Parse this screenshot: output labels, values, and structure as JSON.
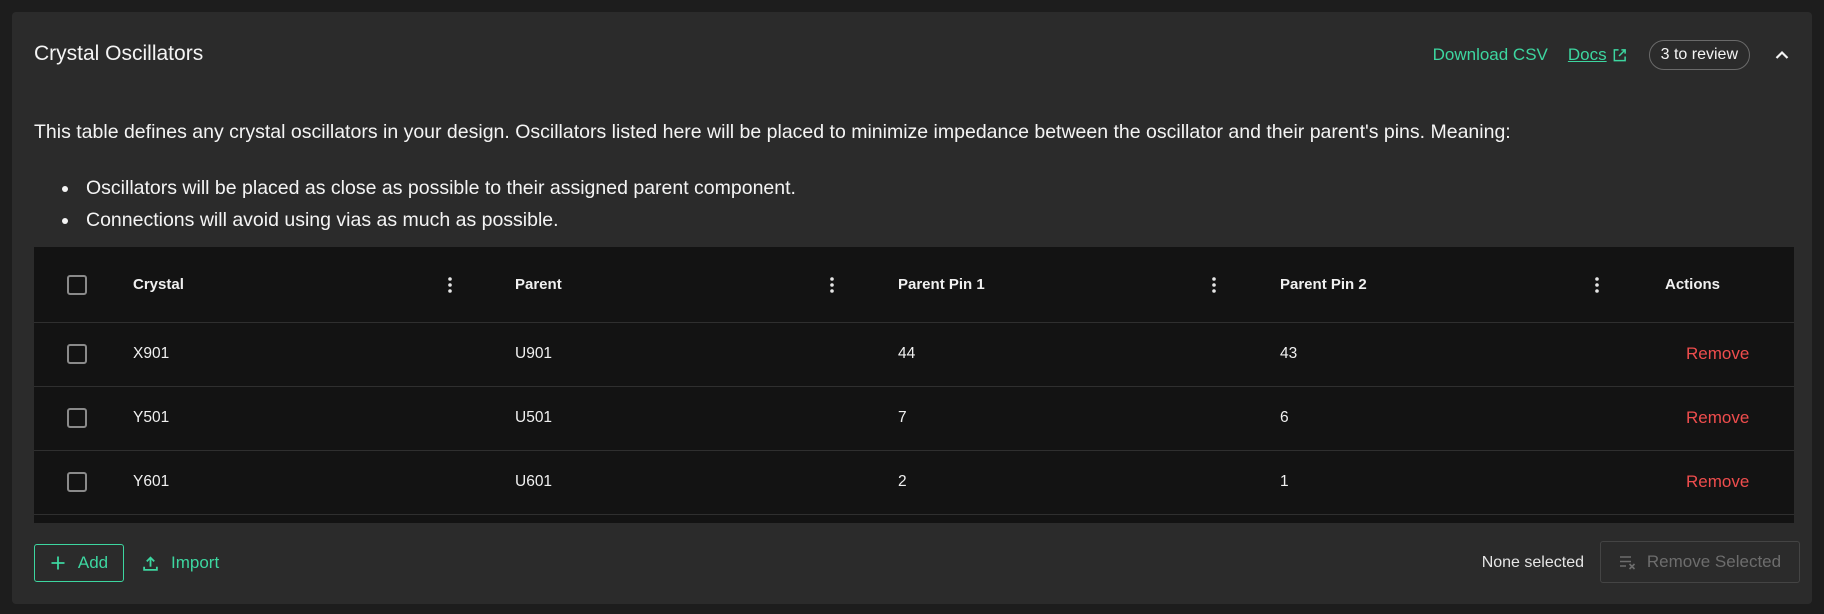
{
  "header": {
    "title": "Crystal Oscillators",
    "download_csv": "Download CSV",
    "docs": "Docs",
    "review_badge": "3 to review"
  },
  "description": "This table defines any crystal oscillators in your design. Oscillators listed here will be placed to minimize impedance between the oscillator and their parent's pins. Meaning:",
  "bullets": [
    "Oscillators will be placed as close as possible to their assigned parent component.",
    "Connections will avoid using vias as much as possible."
  ],
  "table": {
    "columns": [
      "Crystal",
      "Parent",
      "Parent Pin 1",
      "Parent Pin 2",
      "Actions"
    ],
    "rows": [
      {
        "crystal": "X901",
        "parent": "U901",
        "pin1": "44",
        "pin2": "43",
        "action": "Remove"
      },
      {
        "crystal": "Y501",
        "parent": "U501",
        "pin1": "7",
        "pin2": "6",
        "action": "Remove"
      },
      {
        "crystal": "Y601",
        "parent": "U601",
        "pin1": "2",
        "pin2": "1",
        "action": "Remove"
      }
    ]
  },
  "footer": {
    "add_label": "Add",
    "import_label": "Import",
    "selection_status": "None selected",
    "remove_selected_label": "Remove Selected"
  },
  "colors": {
    "accent": "#3dd6a0",
    "danger": "#ef4d4d",
    "panel_bg": "#2b2b2b",
    "table_bg": "#131313"
  }
}
